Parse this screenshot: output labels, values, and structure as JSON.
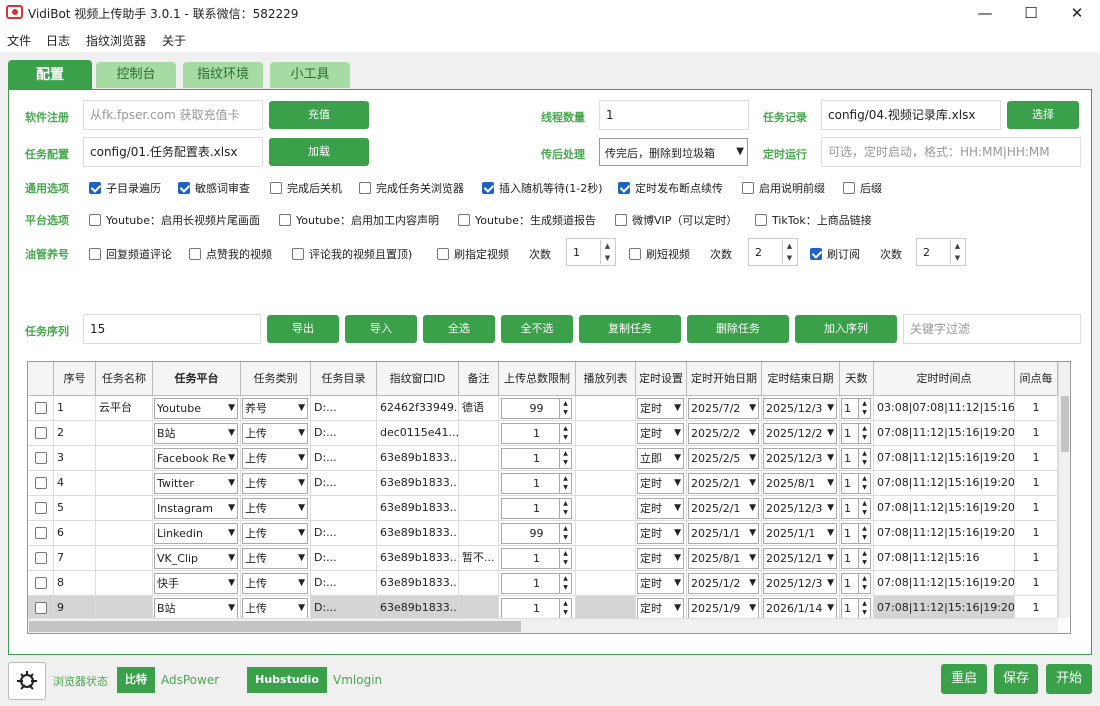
{
  "window": {
    "title": "VidiBot 视频上传助手 3.0.1 - 联系微信：582229"
  },
  "window_controls": {
    "minimize": "—",
    "maximize": "☐",
    "close": "✕"
  },
  "menu": [
    "文件",
    "日志",
    "指纹浏览器",
    "关于"
  ],
  "tabs": [
    "配置",
    "控制台",
    "指纹环境",
    "小工具"
  ],
  "form": {
    "reg_label": "软件注册",
    "reg_placeholder": "从fk.fpser.com 获取充值卡",
    "recharge": "充值",
    "task_cfg_label": "任务配置",
    "task_cfg_value": "config/01.任务配置表.xlsx",
    "load": "加载",
    "threads_label": "线程数量",
    "threads_value": "1",
    "post_label": "传后处理",
    "post_value": "传完后，删除到垃圾箱",
    "record_label": "任务记录",
    "record_value": "config/04.视频记录库.xlsx",
    "choose": "选择",
    "timer_label": "定时运行",
    "timer_placeholder": "可选，定时启动，格式：HH:MM|HH:MM"
  },
  "general": {
    "label": "通用选项",
    "options": [
      {
        "text": "子目录遍历",
        "checked": true
      },
      {
        "text": "敏感词审查",
        "checked": true
      },
      {
        "text": "完成后关机",
        "checked": false
      },
      {
        "text": "完成任务关浏览器",
        "checked": false
      },
      {
        "text": "插入随机等待(1-2秒)",
        "checked": true
      },
      {
        "text": "定时发布断点续传",
        "checked": true
      },
      {
        "text": "启用说明前缀",
        "checked": false
      },
      {
        "text": "后缀",
        "checked": false
      }
    ]
  },
  "platform": {
    "label": "平台选项",
    "options": [
      {
        "text": "Youtube：启用长视频片尾画面",
        "checked": false
      },
      {
        "text": "Youtube：启用加工内容声明",
        "checked": false
      },
      {
        "text": "Youtube：生成频道报告",
        "checked": false
      },
      {
        "text": "微博VIP（可以定时）",
        "checked": false
      },
      {
        "text": "TikTok：上商品链接",
        "checked": false
      }
    ]
  },
  "oil": {
    "label": "油管养号",
    "opt1": "回复频道评论",
    "opt2": "点赞我的视频",
    "opt3": "评论我的视频且置顶)",
    "opt4": "刷指定视频",
    "count_label": "次数",
    "count1": "1",
    "opt5": "刷短视频",
    "count2": "2",
    "opt6": "刷订阅",
    "opt6_checked": true,
    "count3": "2"
  },
  "sequence": {
    "label": "任务序列",
    "value": "15",
    "buttons": [
      "导出",
      "导入",
      "全选",
      "全不选",
      "复制任务",
      "删除任务",
      "加入序列"
    ],
    "filter_placeholder": "关键字过滤"
  },
  "table": {
    "headers": [
      "序号",
      "任务名称",
      "任务平台",
      "任务类别",
      "任务目录",
      "指纹窗口ID",
      "备注",
      "上传总数限制",
      "播放列表",
      "定时设置",
      "定时开始日期",
      "定时结束日期",
      "天数",
      "定时时间点",
      "间点每"
    ],
    "rows": [
      {
        "no": "1",
        "name": "云平台",
        "platform": "Youtube",
        "type": "养号",
        "dir": "D:...",
        "fid": "62462f33949...",
        "note": "德语",
        "limit": "99",
        "timing": "定时",
        "start": "2025/7/2",
        "end": "2025/12/3",
        "days": "1",
        "times": "03:08|07:08|11:12|15:16|...",
        "per": "1"
      },
      {
        "no": "2",
        "name": "",
        "platform": "B站",
        "type": "上传",
        "dir": "D:...",
        "fid": "dec0115e41...",
        "note": "",
        "limit": "1",
        "timing": "定时",
        "start": "2025/2/2",
        "end": "2025/12/2",
        "days": "1",
        "times": "07:08|11:12|15:16|19:20|...",
        "per": "1"
      },
      {
        "no": "3",
        "name": "",
        "platform": "Facebook Re",
        "type": "上传",
        "dir": "D:...",
        "fid": "63e89b1833...",
        "note": "",
        "limit": "1",
        "timing": "立即",
        "start": "2025/2/5",
        "end": "2025/12/3",
        "days": "1",
        "times": "07:08|11:12|15:16|19:20|...",
        "per": "1"
      },
      {
        "no": "4",
        "name": "",
        "platform": "Twitter",
        "type": "上传",
        "dir": "D:...",
        "fid": "63e89b1833...",
        "note": "",
        "limit": "1",
        "timing": "定时",
        "start": "2025/2/1",
        "end": "2025/8/1",
        "days": "1",
        "times": "07:08|11:12|15:16|19:20|...",
        "per": "1"
      },
      {
        "no": "5",
        "name": "",
        "platform": "Instagram",
        "type": "上传",
        "dir": "",
        "fid": "63e89b1833...",
        "note": "",
        "limit": "1",
        "timing": "定时",
        "start": "2025/2/1",
        "end": "2025/12/3",
        "days": "1",
        "times": "07:08|11:12|15:16|19:20|...",
        "per": "1"
      },
      {
        "no": "6",
        "name": "",
        "platform": "Linkedin",
        "type": "上传",
        "dir": "D:...",
        "fid": "63e89b1833...",
        "note": "",
        "limit": "99",
        "timing": "定时",
        "start": "2025/1/1",
        "end": "2025/1/1",
        "days": "1",
        "times": "07:08|11:12|15:16|19:20|...",
        "per": "1"
      },
      {
        "no": "7",
        "name": "",
        "platform": "VK_Clip",
        "type": "上传",
        "dir": "D:...",
        "fid": "63e89b1833...",
        "note": "暂不...",
        "limit": "1",
        "timing": "定时",
        "start": "2025/8/1",
        "end": "2025/12/1",
        "days": "1",
        "times": "07:08|11:12|15:16",
        "per": "1"
      },
      {
        "no": "8",
        "name": "",
        "platform": "快手",
        "type": "上传",
        "dir": "D:...",
        "fid": "63e89b1833...",
        "note": "",
        "limit": "1",
        "timing": "定时",
        "start": "2025/1/2",
        "end": "2025/12/3",
        "days": "1",
        "times": "07:08|11:12|15:16|19:20|...",
        "per": "1"
      },
      {
        "no": "9",
        "name": "",
        "platform": "B站",
        "type": "上传",
        "dir": "D:...",
        "fid": "63e89b1833...",
        "note": "",
        "limit": "1",
        "timing": "定时",
        "start": "2025/1/9",
        "end": "2026/1/14",
        "days": "1",
        "times": "07:08|11:12|15:16|19:20|...",
        "per": "1"
      }
    ]
  },
  "footer": {
    "browser_status": "浏览器状态",
    "bitbrowser": "比特",
    "adspower": "AdsPower",
    "hubstudio": "Hubstudio",
    "vmlogin": "Vmlogin",
    "restart": "重启",
    "save": "保存",
    "start": "开始"
  }
}
